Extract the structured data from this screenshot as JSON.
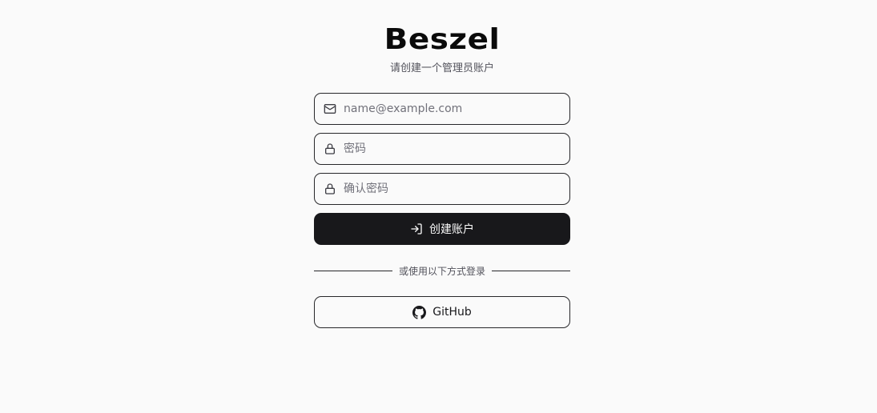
{
  "app": {
    "logo_text": "Beszel",
    "subtitle": "请创建一个管理员账户"
  },
  "form": {
    "email": {
      "placeholder": "name@example.com",
      "value": "",
      "icon": "mail-icon"
    },
    "password": {
      "placeholder": "密码",
      "value": "",
      "icon": "lock-icon"
    },
    "confirm_password": {
      "placeholder": "确认密码",
      "value": "",
      "icon": "lock-icon"
    },
    "submit": {
      "label": "创建账户",
      "icon": "log-in-icon"
    }
  },
  "divider": {
    "text": "或使用以下方式登录"
  },
  "oauth": {
    "github": {
      "label": "GitHub",
      "icon": "github-icon"
    }
  },
  "colors": {
    "background": "#fafafa",
    "primary": "#18181b",
    "primary_text": "#fafafa",
    "border": "#27272a",
    "muted_text": "#52525b"
  }
}
